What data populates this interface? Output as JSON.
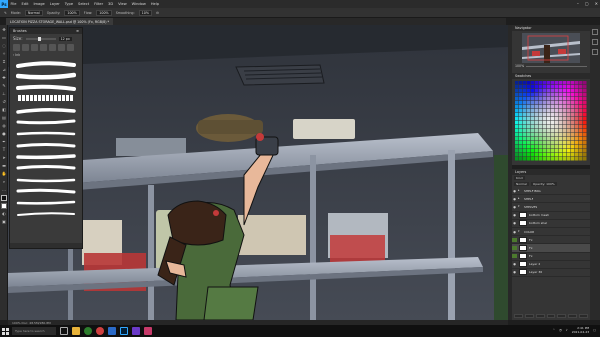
{
  "menubar": {
    "logo": "Ps",
    "items": [
      "File",
      "Edit",
      "Image",
      "Layer",
      "Type",
      "Select",
      "Filter",
      "3D",
      "View",
      "Window",
      "Help"
    ],
    "window_controls": [
      "–",
      "▢",
      "✕"
    ]
  },
  "options_bar": {
    "mode_label": "Mode:",
    "mode_value": "Normal",
    "opacity_label": "Opacity:",
    "opacity_value": "100%",
    "flow_label": "Flow:",
    "flow_value": "100%",
    "smoothing_label": "Smoothing:",
    "smoothing_value": "10%"
  },
  "document": {
    "tab_title": "LOCATION PIZZA STORAGE_WALL.psd @ 100% (Fx, RGB/8) *"
  },
  "brushes_panel": {
    "title": "Brushes",
    "size_label": "Size:",
    "size_value": "12 px",
    "folder_label": "› Ink"
  },
  "navigator": {
    "title": "Navigator",
    "zoom": "100%"
  },
  "swatches": {
    "title": "Swatches"
  },
  "layers": {
    "title": "Layers",
    "kind_label": "Kind",
    "blend_mode": "Normal",
    "opacity": "Opacity: 100%",
    "items": [
      {
        "name": "SHELF BKG",
        "group": true
      },
      {
        "name": "SHELF",
        "group": true
      },
      {
        "name": "SHELVES",
        "group": true
      },
      {
        "name": "bottom mesh",
        "group": false
      },
      {
        "name": "bottom shel",
        "group": false
      },
      {
        "name": "COLOR",
        "group": true
      },
      {
        "name": "Fx",
        "group": false
      },
      {
        "name": "Fx",
        "group": false
      },
      {
        "name": "Fx",
        "group": false
      },
      {
        "name": "Layer 2",
        "group": false
      },
      {
        "name": "Layer 36",
        "group": false
      }
    ]
  },
  "status_bar": {
    "text": "100%    Doc: 48.5M/280.8M"
  },
  "taskbar": {
    "search_placeholder": "Type here to search",
    "time": "2:41 PM",
    "date": "2021-04-23"
  },
  "colors": {
    "accent": "#31a8ff",
    "panel_bg": "#353535",
    "shirt_green": "#4a6a3a",
    "tomato": "#c43a3a"
  }
}
